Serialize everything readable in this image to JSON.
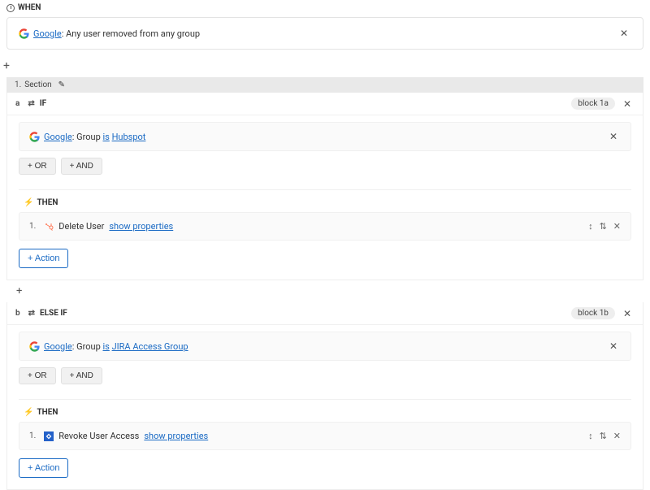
{
  "when": {
    "label": "WHEN",
    "provider": "Google",
    "trigger_text": ": Any user removed from any group"
  },
  "section": {
    "ordinal": "1.",
    "label": "Section"
  },
  "blocks": [
    {
      "ordinal": "a",
      "kind": "IF",
      "badge": "block 1a",
      "condition": {
        "provider": "Google",
        "prefix": ": Group ",
        "verb": "is",
        "value": "Hubspot"
      },
      "or_btn": "+ OR",
      "and_btn": "+ AND",
      "then_label": "THEN",
      "action": {
        "ordinal": "1.",
        "icon": "hubspot",
        "label": "Delete User",
        "props": "show properties"
      },
      "add_action": "+ Action"
    },
    {
      "ordinal": "b",
      "kind": "ELSE IF",
      "badge": "block 1b",
      "condition": {
        "provider": "Google",
        "prefix": ": Group ",
        "verb": "is",
        "value": "JIRA Access Group"
      },
      "or_btn": "+ OR",
      "and_btn": "+ AND",
      "then_label": "THEN",
      "action": {
        "ordinal": "1.",
        "icon": "jira",
        "label": "Revoke User Access",
        "props": "show properties"
      },
      "add_action": "+ Action"
    }
  ]
}
